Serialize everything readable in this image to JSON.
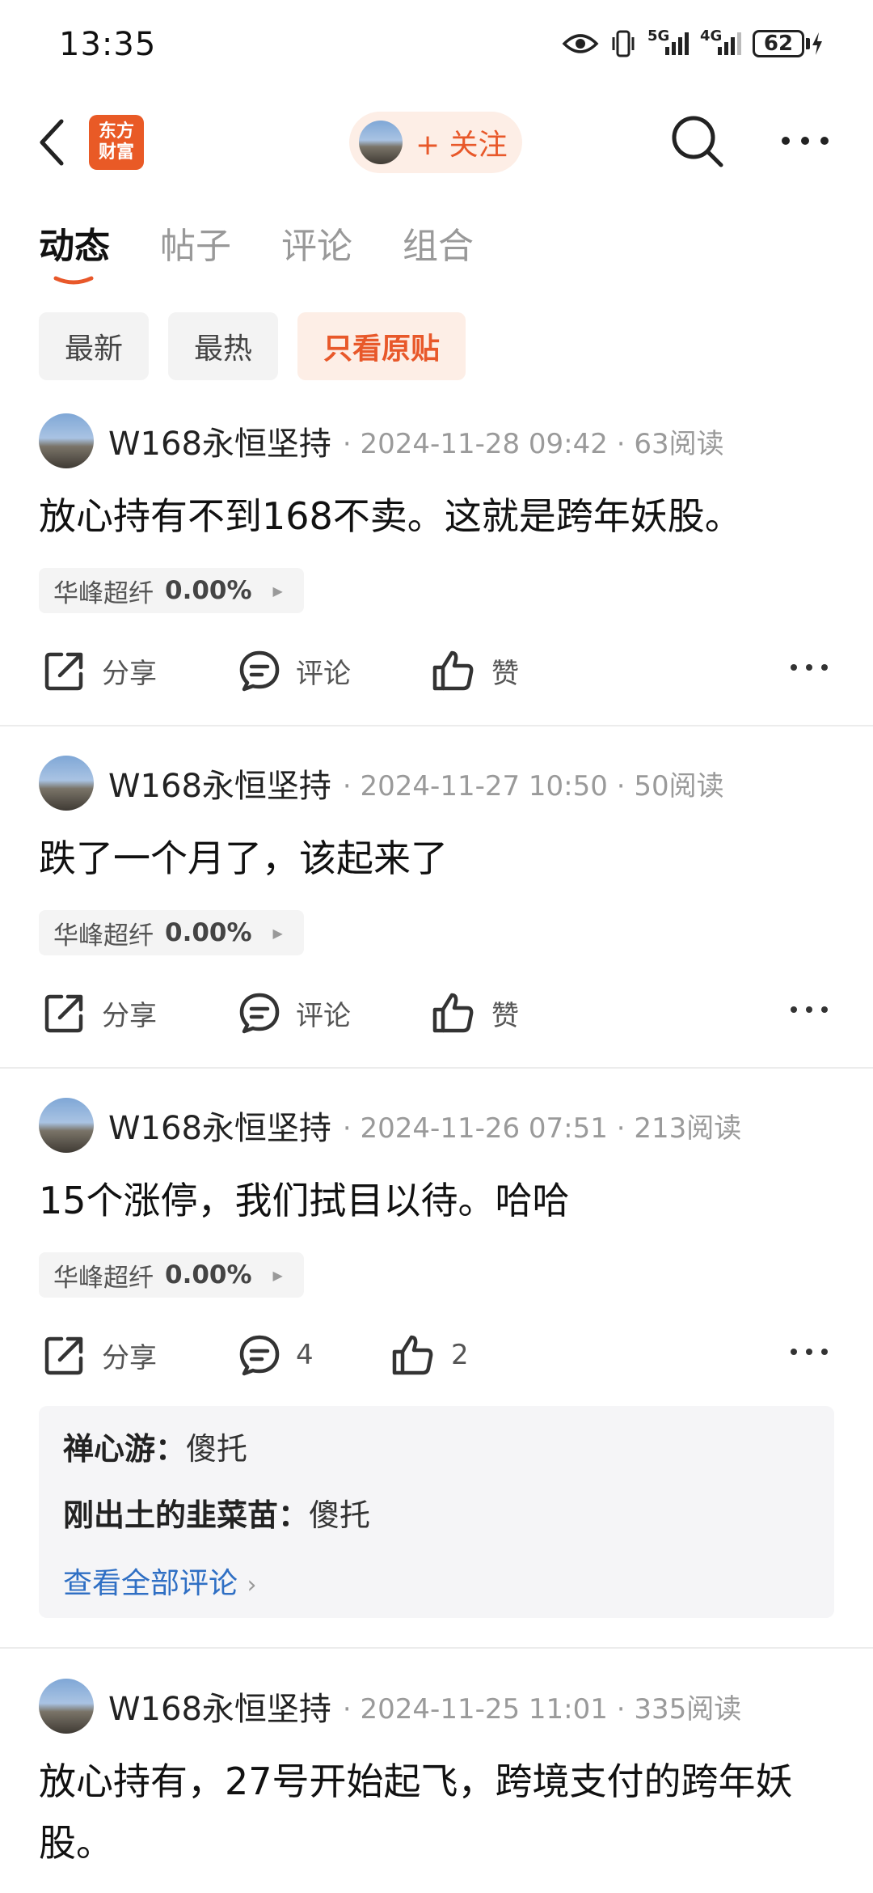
{
  "status_bar": {
    "time": "13:35",
    "battery": "62",
    "net1": "5G",
    "net2": "4G"
  },
  "nav": {
    "logo_line1": "东方",
    "logo_line2": "财富",
    "follow_label": "+ 关注"
  },
  "tabs": [
    "动态",
    "帖子",
    "评论",
    "组合"
  ],
  "filters": [
    "最新",
    "最热",
    "只看原贴"
  ],
  "actions": {
    "share": "分享",
    "comment": "评论",
    "like": "赞"
  },
  "posts": [
    {
      "author": "W168永恒坚持",
      "meta": "· 2024-11-28 09:42 · 63阅读",
      "content": "放心持有不到168不卖。这就是跨年妖股。",
      "stock": "华峰超纤",
      "pct": "0.00%",
      "comment_label": "评论",
      "like_label": "赞"
    },
    {
      "author": "W168永恒坚持",
      "meta": "· 2024-11-27 10:50 · 50阅读",
      "content": "跌了一个月了，该起来了",
      "stock": "华峰超纤",
      "pct": "0.00%",
      "comment_label": "评论",
      "like_label": "赞"
    },
    {
      "author": "W168永恒坚持",
      "meta": "· 2024-11-26 07:51 · 213阅读",
      "content": "15个涨停，我们拭目以待。哈哈",
      "stock": "华峰超纤",
      "pct": "0.00%",
      "comment_label": "4",
      "like_label": "2",
      "comments": [
        {
          "user": "禅心游",
          "text": "傻托"
        },
        {
          "user": "刚出土的韭菜苗",
          "text": "傻托"
        }
      ],
      "view_all": "查看全部评论"
    },
    {
      "author": "W168永恒坚持",
      "meta": "· 2024-11-25 11:01 · 335阅读",
      "content": "放心持有，27号开始起飞，跨境支付的跨年妖股。"
    }
  ]
}
